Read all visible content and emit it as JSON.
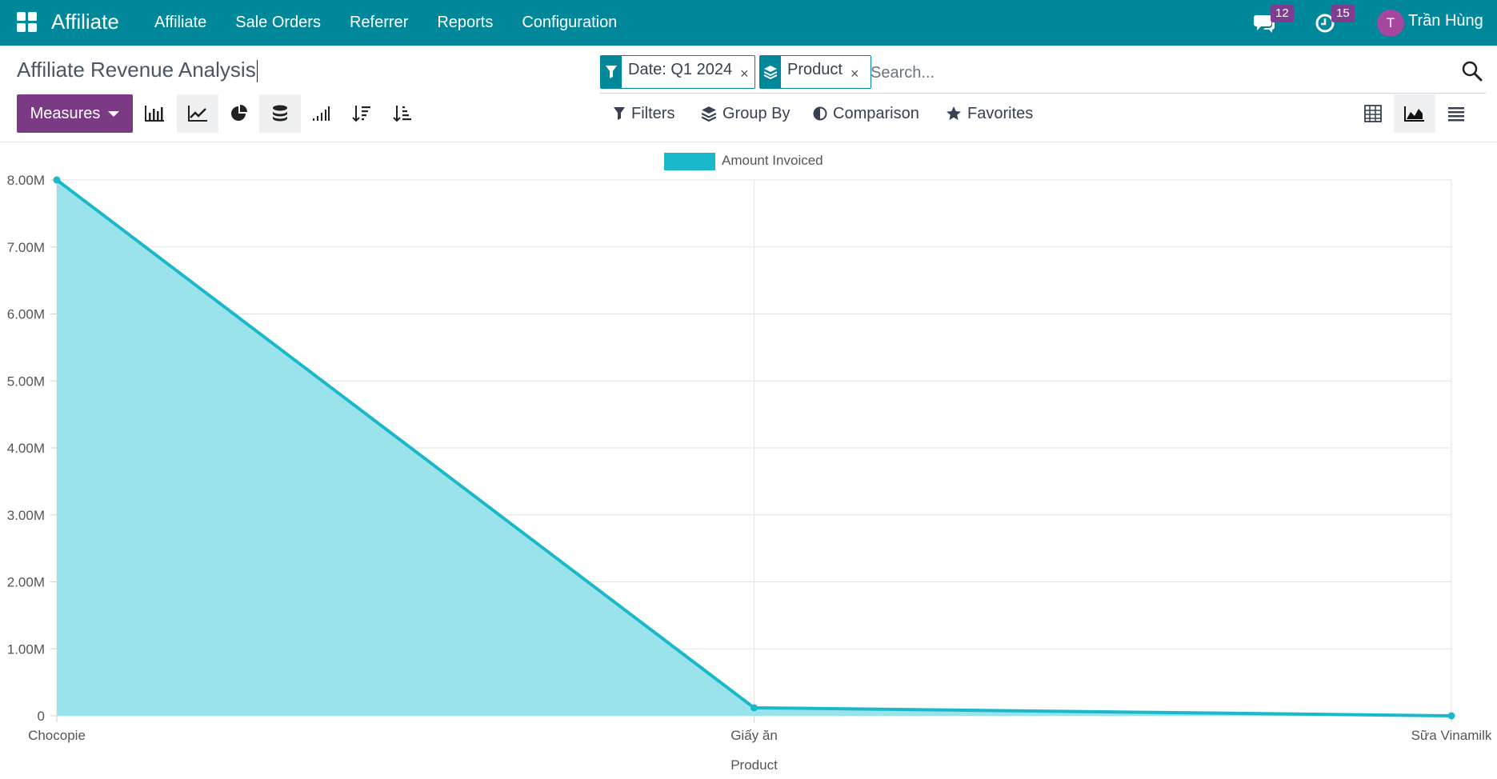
{
  "navbar": {
    "brand": "Affiliate",
    "menu": [
      "Affiliate",
      "Sale Orders",
      "Referrer",
      "Reports",
      "Configuration"
    ],
    "messages_count": "12",
    "activities_count": "15",
    "avatar_initial": "T",
    "user_name": "Trần Hùng"
  },
  "control_panel": {
    "title": "Affiliate Revenue Analysis",
    "facets": [
      {
        "type": "filter",
        "label": "Date: Q1 2024",
        "icon": "filter-icon"
      },
      {
        "type": "groupby",
        "label": "Product",
        "icon": "layers-icon"
      }
    ],
    "search_placeholder": "Search...",
    "measures_label": "Measures",
    "chart_tools": [
      "bar-chart-icon",
      "line-chart-icon",
      "pie-chart-icon",
      "stacked-icon",
      "cumulative-icon",
      "sort-descending-icon",
      "sort-ascending-icon"
    ],
    "filters_label": "Filters",
    "group_by_label": "Group By",
    "comparison_label": "Comparison",
    "favorites_label": "Favorites",
    "views": [
      "pivot-view-icon",
      "graph-view-icon",
      "list-view-icon"
    ],
    "active_view": "graph"
  },
  "colors": {
    "navbar": "#00889a",
    "brand_purple": "#7a3b84",
    "series_line": "#1ab8cb",
    "series_fill": "#9be3ea"
  },
  "chart_data": {
    "type": "area",
    "categories": [
      "Chocopie",
      "Giấy ăn",
      "Sữa Vinamilk"
    ],
    "series": [
      {
        "name": "Amount Invoiced",
        "values": [
          8000000,
          120000,
          0
        ]
      }
    ],
    "xlabel": "Product",
    "ylabel": "",
    "ylim": [
      0,
      8000000
    ],
    "yticks": [
      {
        "value": 0,
        "label": "0"
      },
      {
        "value": 1000000,
        "label": "1.00M"
      },
      {
        "value": 2000000,
        "label": "2.00M"
      },
      {
        "value": 3000000,
        "label": "3.00M"
      },
      {
        "value": 4000000,
        "label": "4.00M"
      },
      {
        "value": 5000000,
        "label": "5.00M"
      },
      {
        "value": 6000000,
        "label": "6.00M"
      },
      {
        "value": 7000000,
        "label": "7.00M"
      },
      {
        "value": 8000000,
        "label": "8.00M"
      }
    ],
    "legend_position": "top",
    "grid": true
  }
}
